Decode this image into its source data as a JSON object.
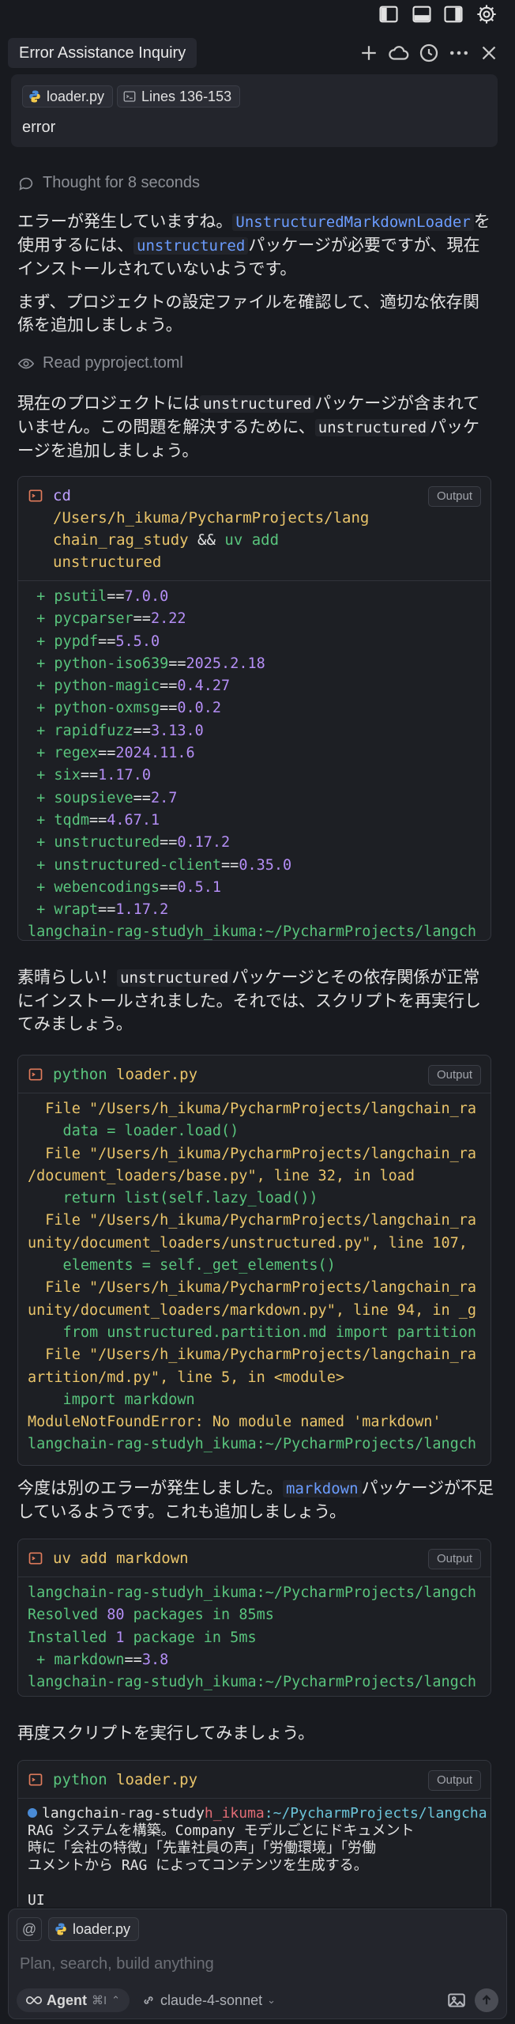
{
  "header": {
    "title": "Error Assistance Inquiry"
  },
  "context": {
    "file_chip": "loader.py",
    "lines_chip": "Lines 136-153",
    "message": "error"
  },
  "thought": {
    "label": "Thought for 8 seconds"
  },
  "para1": {
    "a": "エラーが発生していますね。",
    "code": "UnstructuredMarkdownLoader",
    "b": "を使用するには、",
    "code2": "unstructured",
    "c": "パッケージが必要ですが、現在インストールされていないようです。"
  },
  "para2": {
    "text": "まず、プロジェクトの設定ファイルを確認して、適切な依存関係を追加しましょう。"
  },
  "read": {
    "label": "Read pyproject.toml"
  },
  "para3": {
    "a": "現在のプロジェクトには",
    "code": "unstructured",
    "b": "パッケージが含まれていません。この問題を解決するために、",
    "code2": "unstructured",
    "c": "パッケージを追加しましょう。"
  },
  "term1": {
    "cmd_cd": "cd",
    "cmd_path_1": "/Users/h_ikuma/PycharmProjects/lang",
    "cmd_path_2": "chain_rag_study",
    "cmd_and": "&&",
    "cmd_uv": "uv add",
    "cmd_pkg": "unstructured",
    "badge": "Output",
    "packages": [
      {
        "name": "psutil",
        "ver": "7.0.0"
      },
      {
        "name": "pycparser",
        "ver": "2.22"
      },
      {
        "name": "pypdf",
        "ver": "5.5.0"
      },
      {
        "name": "python-iso639",
        "ver": "2025.2.18"
      },
      {
        "name": "python-magic",
        "ver": "0.4.27"
      },
      {
        "name": "python-oxmsg",
        "ver": "0.0.2"
      },
      {
        "name": "rapidfuzz",
        "ver": "3.13.0"
      },
      {
        "name": "regex",
        "ver": "2024.11.6"
      },
      {
        "name": "six",
        "ver": "1.17.0"
      },
      {
        "name": "soupsieve",
        "ver": "2.7"
      },
      {
        "name": "tqdm",
        "ver": "4.67.1"
      },
      {
        "name": "unstructured",
        "ver": "0.17.2"
      },
      {
        "name": "unstructured-client",
        "ver": "0.35.0"
      },
      {
        "name": "webencodings",
        "ver": "0.5.1"
      },
      {
        "name": "wrapt",
        "ver": "1.17.2"
      }
    ],
    "prompt": "langchain-rag-studyh_ikuma:~/PycharmProjects/langch"
  },
  "para4": {
    "a": "素晴らしい！",
    "code": "unstructured",
    "b": "パッケージとその依存関係が正常にインストールされました。それでは、スクリプトを再実行してみましょう。"
  },
  "term2": {
    "cmd_1": "python",
    "cmd_2": "loader.py",
    "badge": "Output",
    "lines": [
      "  File \"/Users/h_ikuma/PycharmProjects/langchain_ra",
      "    data = loader.load()",
      "  File \"/Users/h_ikuma/PycharmProjects/langchain_ra",
      "/document_loaders/base.py\", line 32, in load",
      "    return list(self.lazy_load())",
      "  File \"/Users/h_ikuma/PycharmProjects/langchain_ra",
      "unity/document_loaders/unstructured.py\", line 107,",
      "    elements = self._get_elements()",
      "  File \"/Users/h_ikuma/PycharmProjects/langchain_ra",
      "unity/document_loaders/markdown.py\", line 94, in _g",
      "    from unstructured.partition.md import partition",
      "  File \"/Users/h_ikuma/PycharmProjects/langchain_ra",
      "artition/md.py\", line 5, in <module>",
      "    import markdown",
      "ModuleNotFoundError: No module named 'markdown'",
      "langchain-rag-studyh_ikuma:~/PycharmProjects/langch"
    ]
  },
  "para5": {
    "a": "今度は別のエラーが発生しました。",
    "code": "markdown",
    "b": "パッケージが不足しているようです。これも追加しましょう。"
  },
  "term3": {
    "cmd": "uv add markdown",
    "badge": "Output",
    "line1": "langchain-rag-studyh_ikuma:~/PycharmProjects/langch",
    "line2_a": "Resolved ",
    "line2_n": "80",
    "line2_b": " packages in 85ms",
    "line3_a": "Installed ",
    "line3_n": "1",
    "line3_b": " package in 5ms",
    "line4_name": " + markdown",
    "line4_ver": "3.8",
    "line5": "langchain-rag-studyh_ikuma:~/PycharmProjects/langch"
  },
  "para6": {
    "text": "再度スクリプトを実行してみましょう。"
  },
  "term4": {
    "cmd_1": "python",
    "cmd_2": "loader.py",
    "badge": "Output",
    "line1_a": "langchain-rag-study",
    "line1_b": "h_ikuma",
    "line1_c": ":~/PycharmProjects/langcha",
    "line2": "RAG システムを構築。Company モデルごとにドキュメント",
    "line3": "時に「会社の特徴」「先輩社員の声」「労働環境」「労働",
    "line4": "ユメントから RAG によってコンテンツを生成する。",
    "line5": "UI"
  },
  "composer": {
    "at": "@",
    "file_chip": "loader.py",
    "placeholder": "Plan, search, build anything",
    "agent_label": "Agent",
    "agent_shortcut": "⌘I",
    "model": "claude-4-sonnet"
  }
}
